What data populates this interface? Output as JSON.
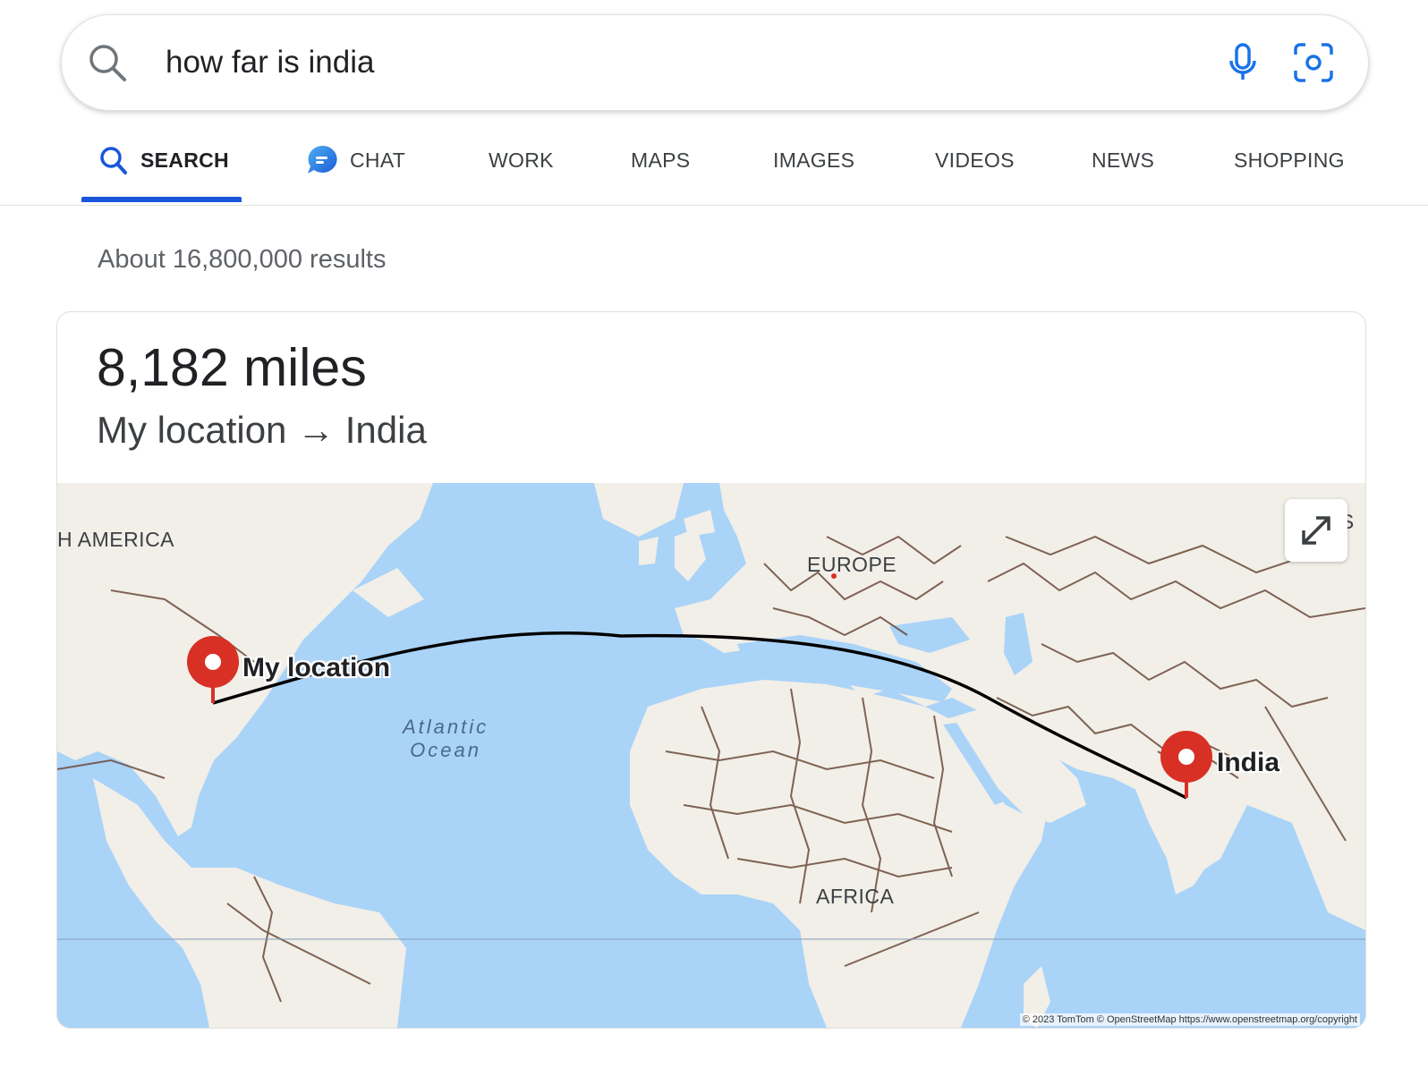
{
  "search": {
    "query": "how far is india"
  },
  "icons": {
    "search": "search-icon",
    "mic": "microphone-icon",
    "lens": "camera-lens-icon",
    "chat": "chat-bubble-icon",
    "expand": "expand-icon",
    "pin": "map-pin-icon"
  },
  "tabs": [
    {
      "label": "SEARCH",
      "active": true
    },
    {
      "label": "CHAT",
      "active": false
    },
    {
      "label": "WORK",
      "active": false
    },
    {
      "label": "MAPS",
      "active": false
    },
    {
      "label": "IMAGES",
      "active": false
    },
    {
      "label": "VIDEOS",
      "active": false
    },
    {
      "label": "NEWS",
      "active": false
    },
    {
      "label": "SHOPPING",
      "active": false
    }
  ],
  "results": {
    "count_text": "About 16,800,000 results"
  },
  "answer": {
    "distance": "8,182 miles",
    "route": "My location → India"
  },
  "map": {
    "regions": {
      "america": "H AMERICA",
      "europe": "EUROPE",
      "africa": "AFRICA",
      "asia": "AS"
    },
    "ocean": {
      "line1": "Atlantic",
      "line2": "Ocean"
    },
    "origin_label": "My location",
    "destination_label": "India",
    "attribution": "© 2023 TomTom © OpenStreetMap https://www.openstreetmap.org/copyright"
  },
  "colors": {
    "accent": "#1a56db",
    "pin": "#d93025",
    "water": "#aad3f8",
    "land": "#f1efe8",
    "border": "#6b4a3a"
  }
}
